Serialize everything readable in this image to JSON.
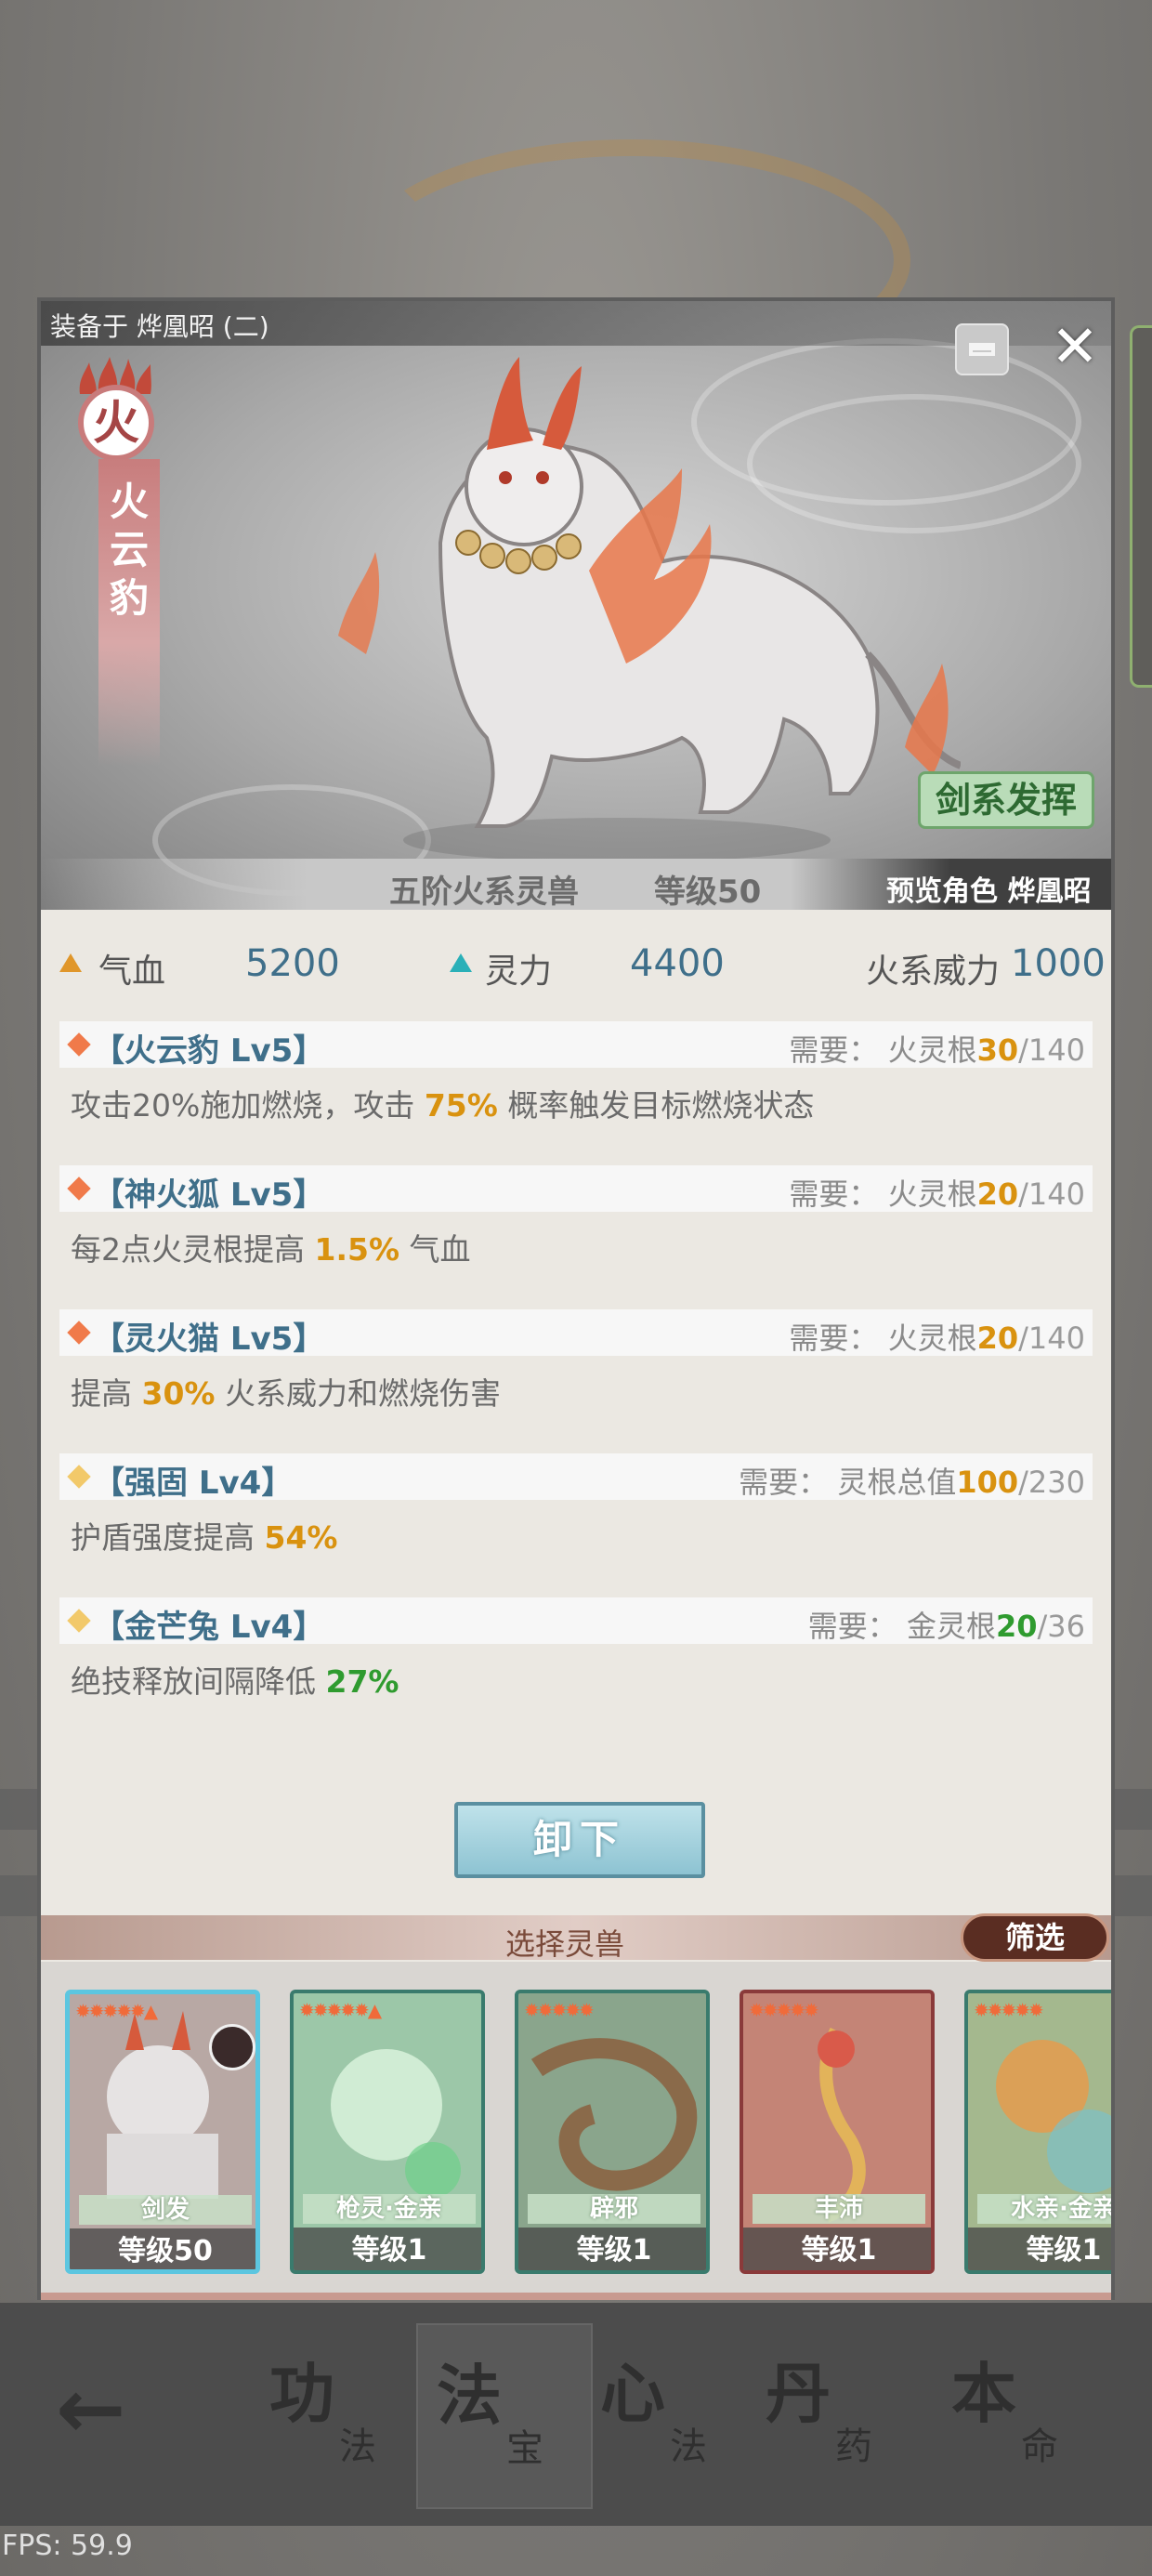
{
  "modal": {
    "equipped_label": "装备于 烨凰昭 (二)",
    "element_char": "火",
    "beast_name_vertical": "火云豹",
    "style_tag": "剑系发挥",
    "tier_text": "五阶火系灵兽",
    "level_text": "等级50",
    "preview_text": "预览角色 烨凰昭",
    "close_icon": "✕",
    "collapse_icon": "collapse-icon"
  },
  "stats": {
    "hp_label": "气血",
    "hp_value": "5200",
    "spirit_label": "灵力",
    "spirit_value": "4400",
    "fire_power_label": "火系威力",
    "fire_power_value": "1000",
    "hp_color": "#e0962a",
    "spirit_color": "#2ab0b8"
  },
  "skills": [
    {
      "name": "【火云豹 Lv5】",
      "diamond_color": "#f07a4a",
      "req_prefix": "需要：  火灵根",
      "req_current": "30",
      "req_max": "/140",
      "req_color": "orange",
      "desc_pre": "攻击20%施加燃烧，攻击 ",
      "desc_hl": "75%",
      "desc_post": " 概率触发目标燃烧状态",
      "desc_hl_color": "orange"
    },
    {
      "name": "【神火狐 Lv5】",
      "diamond_color": "#f07a4a",
      "req_prefix": "需要：  火灵根",
      "req_current": "20",
      "req_max": "/140",
      "req_color": "orange",
      "desc_pre": "每2点火灵根提高 ",
      "desc_hl": "1.5%",
      "desc_post": " 气血",
      "desc_hl_color": "orange"
    },
    {
      "name": "【灵火猫 Lv5】",
      "diamond_color": "#f07a4a",
      "req_prefix": "需要：  火灵根",
      "req_current": "20",
      "req_max": "/140",
      "req_color": "orange",
      "desc_pre": "提高 ",
      "desc_hl": "30%",
      "desc_post": " 火系威力和燃烧伤害",
      "desc_hl_color": "orange"
    },
    {
      "name": "【强固 Lv4】",
      "diamond_color": "#f2c96a",
      "req_prefix": "需要：  灵根总值",
      "req_current": "100",
      "req_max": "/230",
      "req_color": "orange",
      "desc_pre": "护盾强度提高 ",
      "desc_hl": "54%",
      "desc_post": "",
      "desc_hl_color": "orange"
    },
    {
      "name": "【金芒兔 Lv4】",
      "diamond_color": "#f2c96a",
      "req_prefix": "需要：  金灵根",
      "req_current": "20",
      "req_max": "/36",
      "req_color": "green",
      "desc_pre": "绝技释放间隔降低 ",
      "desc_hl": "27%",
      "desc_post": "",
      "desc_hl_color": "green"
    }
  ],
  "unequip_label": "卸下",
  "select": {
    "title": "选择灵兽",
    "filter_label": "筛选",
    "cards": [
      {
        "tag": "剑发",
        "level": "等级50",
        "stars": "✹✹✹✹✹▲",
        "bg": "#b8a8a4",
        "border": "selected"
      },
      {
        "tag": "枪灵·金亲",
        "level": "等级1",
        "stars": "✹✹✹✹✹▲",
        "bg": "#9cc7a8",
        "border": "green"
      },
      {
        "tag": "辟邪",
        "level": "等级1",
        "stars": "✹✹✹✹✹",
        "bg": "#8aa58c",
        "border": "green"
      },
      {
        "tag": "丰沛",
        "level": "等级1",
        "stars": "✹✹✹✹✹",
        "bg": "#c48476",
        "border": "red"
      },
      {
        "tag": "水亲·金亲",
        "level": "等级1",
        "stars": "✹✹✹✹✹",
        "bg": "#a4b88e",
        "border": "green"
      }
    ]
  },
  "nav": {
    "back_icon": "←",
    "items": [
      {
        "main": "功",
        "sub": "法"
      },
      {
        "main": "法",
        "sub": "宝"
      },
      {
        "main": "心",
        "sub": "法"
      },
      {
        "main": "丹",
        "sub": "药"
      },
      {
        "main": "本",
        "sub": "命"
      }
    ]
  },
  "fps": "FPS: 59.9"
}
